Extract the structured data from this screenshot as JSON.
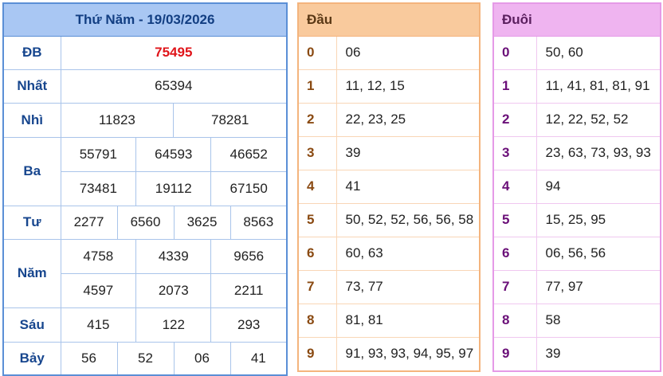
{
  "results": {
    "title": "Thứ Năm - 19/03/2026",
    "prizes": {
      "db": {
        "label": "ĐB",
        "values": [
          "75495"
        ]
      },
      "nhat": {
        "label": "Nhất",
        "values": [
          "65394"
        ]
      },
      "nhi": {
        "label": "Nhì",
        "values": [
          "11823",
          "78281"
        ]
      },
      "ba": {
        "label": "Ba",
        "values": [
          "55791",
          "64593",
          "46652",
          "73481",
          "19112",
          "67150"
        ]
      },
      "tu": {
        "label": "Tư",
        "values": [
          "2277",
          "6560",
          "3625",
          "8563"
        ]
      },
      "nam": {
        "label": "Năm",
        "values": [
          "4758",
          "4339",
          "9656",
          "4597",
          "2073",
          "2211"
        ]
      },
      "sau": {
        "label": "Sáu",
        "values": [
          "415",
          "122",
          "293"
        ]
      },
      "bay": {
        "label": "Bảy",
        "values": [
          "56",
          "52",
          "06",
          "41"
        ]
      }
    }
  },
  "head": {
    "title": "Đầu",
    "rows": [
      {
        "key": "0",
        "value": "06"
      },
      {
        "key": "1",
        "value": "11, 12, 15"
      },
      {
        "key": "2",
        "value": "22, 23, 25"
      },
      {
        "key": "3",
        "value": "39"
      },
      {
        "key": "4",
        "value": "41"
      },
      {
        "key": "5",
        "value": "50, 52, 52, 56, 56, 58"
      },
      {
        "key": "6",
        "value": "60, 63"
      },
      {
        "key": "7",
        "value": "73, 77"
      },
      {
        "key": "8",
        "value": "81, 81"
      },
      {
        "key": "9",
        "value": "91, 93, 93, 94, 95, 97"
      }
    ]
  },
  "tail": {
    "title": "Đuôi",
    "rows": [
      {
        "key": "0",
        "value": "50, 60"
      },
      {
        "key": "1",
        "value": "11, 41, 81, 81, 91"
      },
      {
        "key": "2",
        "value": "12, 22, 52, 52"
      },
      {
        "key": "3",
        "value": "23, 63, 73, 93, 93"
      },
      {
        "key": "4",
        "value": "94"
      },
      {
        "key": "5",
        "value": "15, 25, 95"
      },
      {
        "key": "6",
        "value": "06, 56, 56"
      },
      {
        "key": "7",
        "value": "77, 97"
      },
      {
        "key": "8",
        "value": "58"
      },
      {
        "key": "9",
        "value": "39"
      }
    ]
  }
}
